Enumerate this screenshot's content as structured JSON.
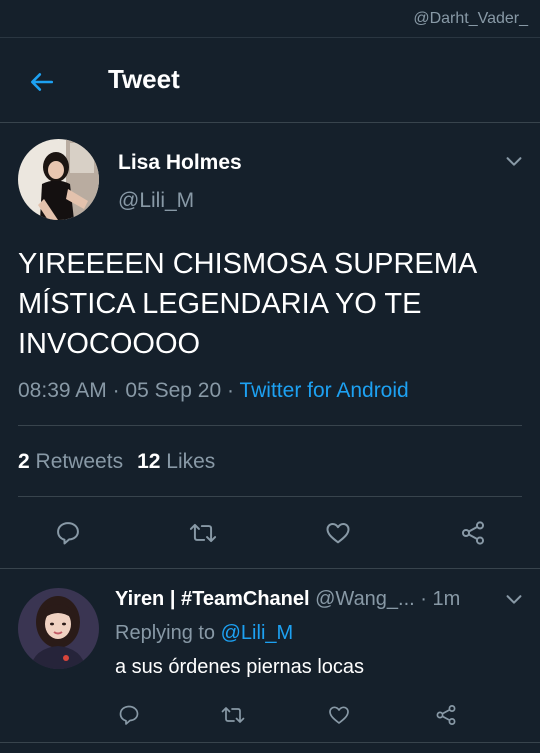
{
  "watermark": "@Darht_Vader_",
  "header": {
    "title": "Tweet"
  },
  "tweet": {
    "author_name": "Lisa Holmes",
    "author_handle": "@Lili_M",
    "text_line1": "YIREEEEN CHISMOSA SUPREMA",
    "text_line2": "MÍSTICA LEGENDARIA YO TE",
    "text_line3": "INVOCOOOO",
    "time": "08:39 AM",
    "date": "05 Sep 20",
    "source": "Twitter for Android",
    "retweet_count": "2",
    "retweet_label": "Retweets",
    "like_count": "12",
    "like_label": "Likes"
  },
  "reply": {
    "author_name": "Yiren | #TeamChanel",
    "author_handle": "@Wang_...",
    "age": "1m",
    "replying_prefix": "Replying to",
    "replying_to": "@Lili_M",
    "text": "a sus órdenes piernas locas"
  },
  "icons": {
    "back": "arrow-left-icon",
    "more": "chevron-down-icon",
    "reply": "comment-icon",
    "retweet": "retweet-icon",
    "like": "heart-icon",
    "share": "share-icon"
  },
  "colors": {
    "background": "#15202b",
    "accent": "#1da1f2",
    "secondary_text": "#8899a6",
    "divider": "#38444d"
  }
}
